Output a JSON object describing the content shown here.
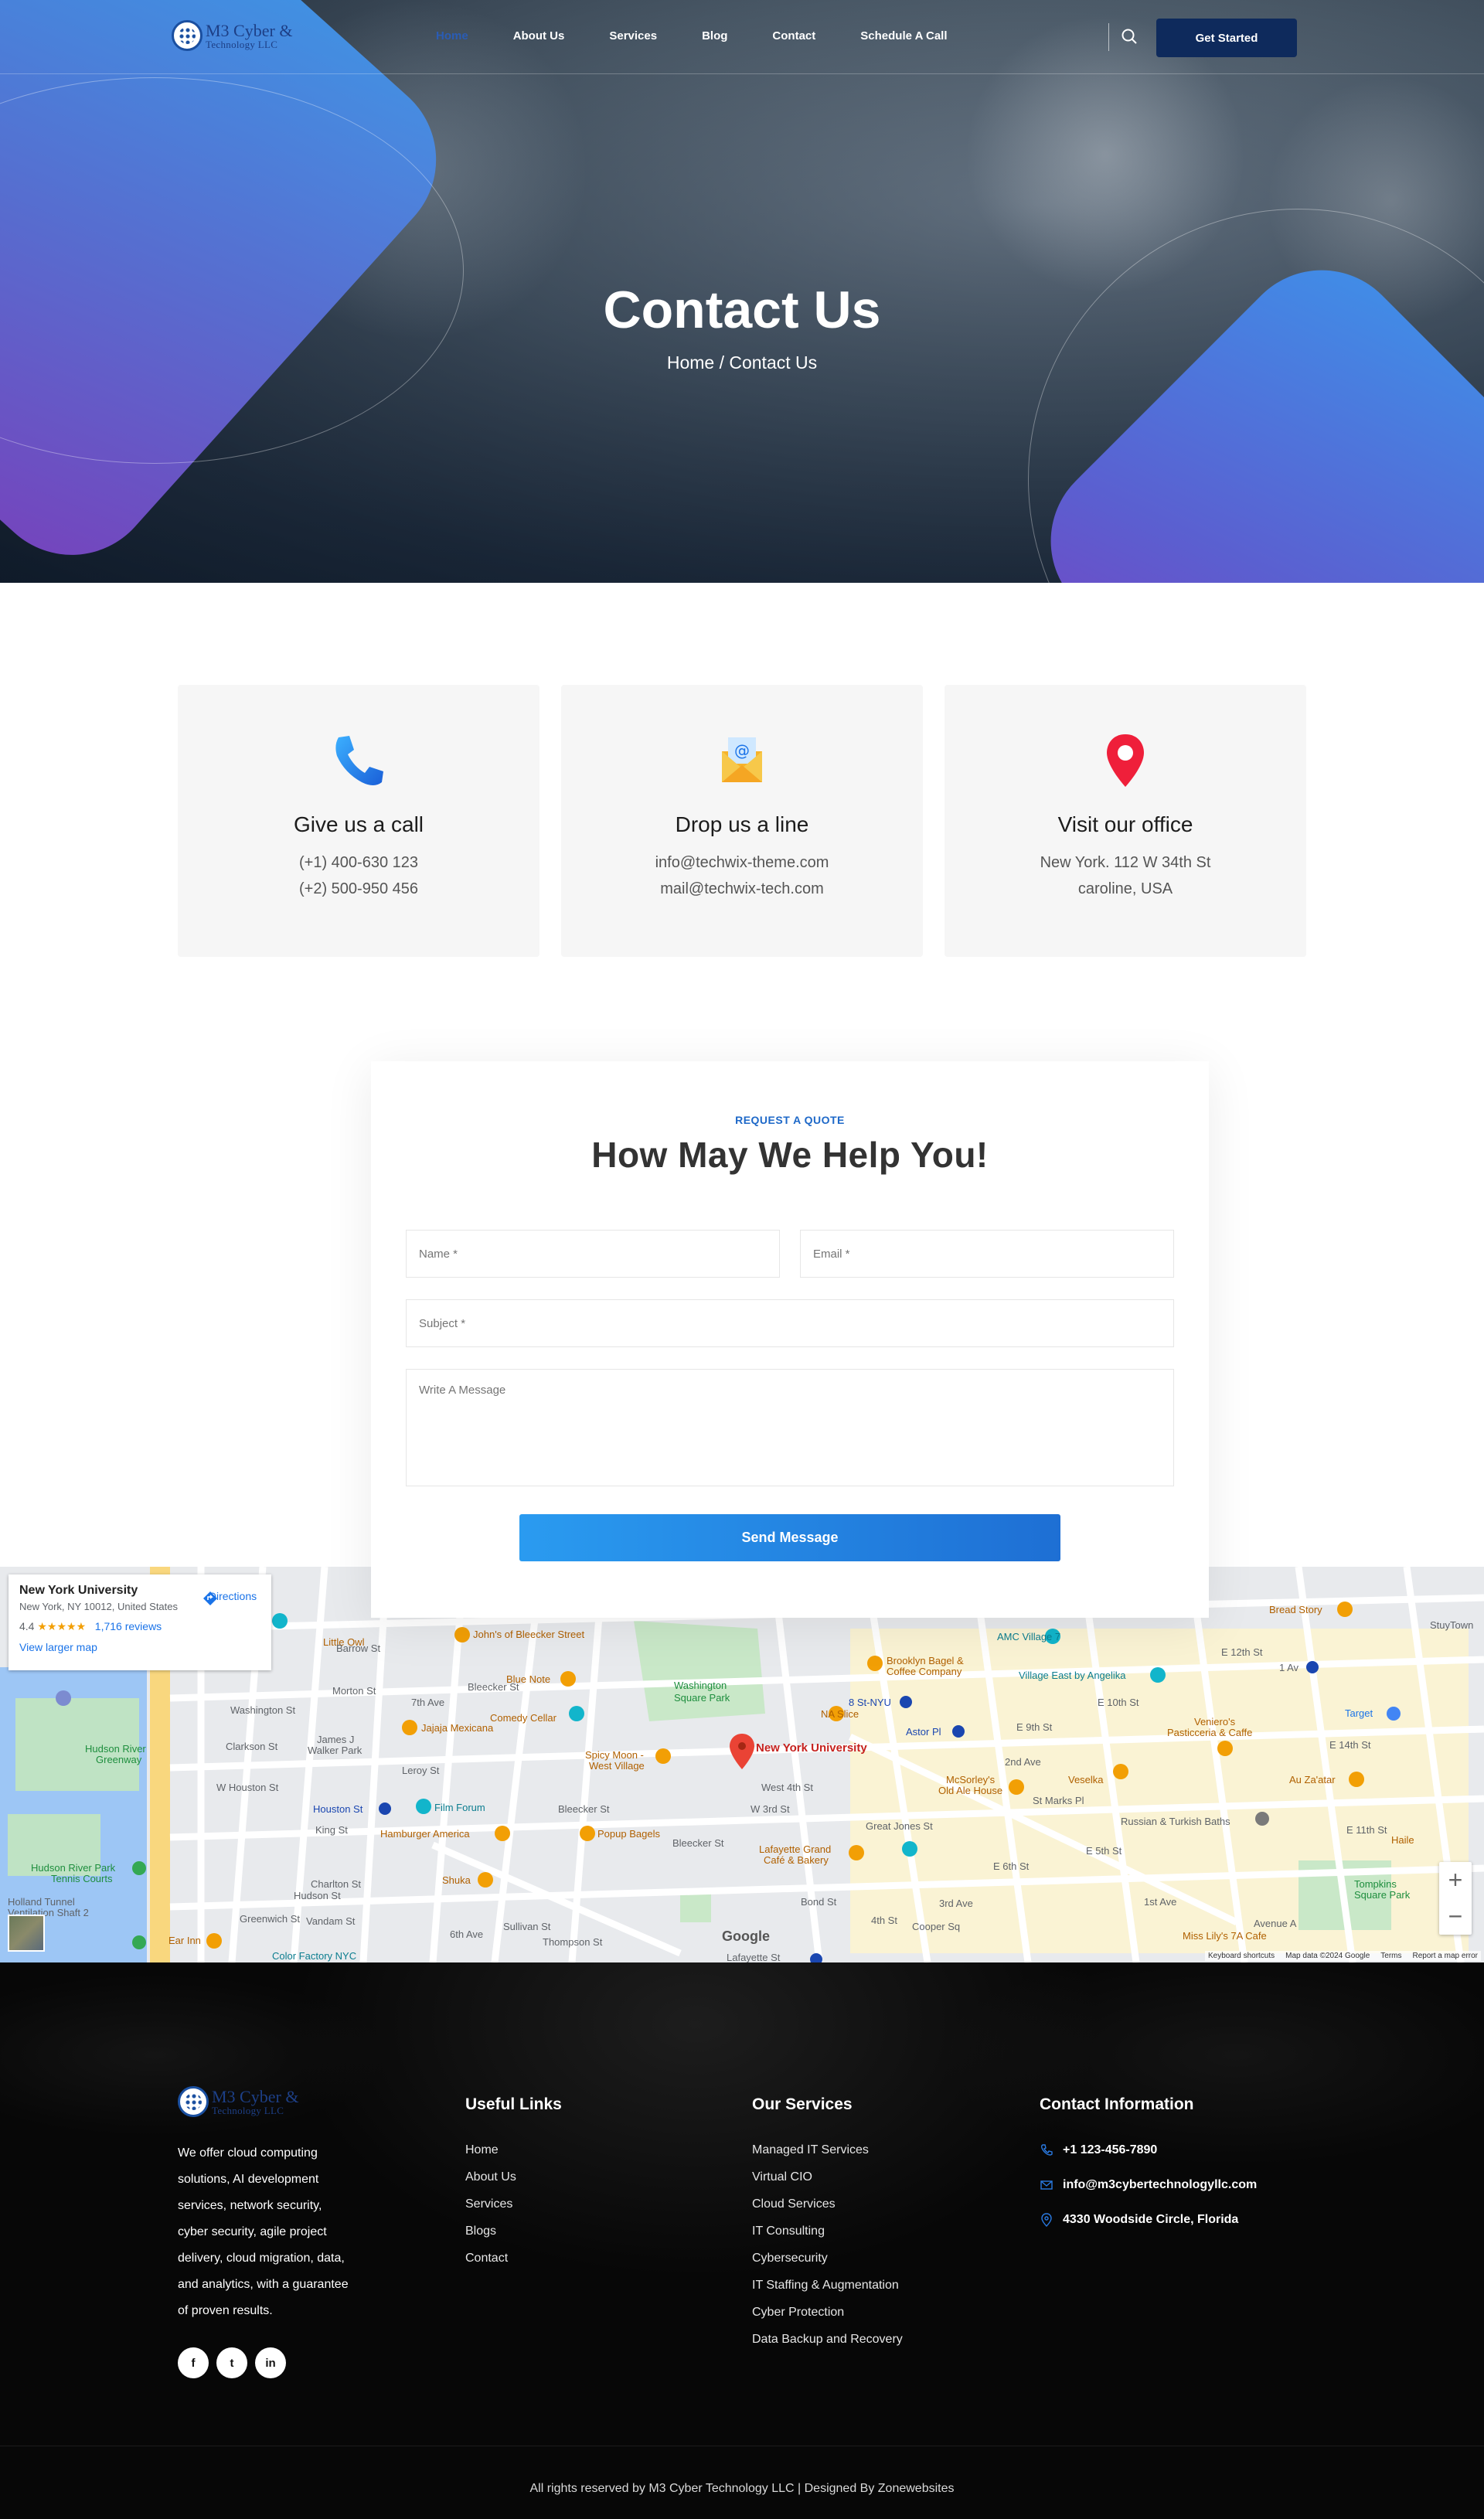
{
  "brand": {
    "name_line1": "M3 Cyber &",
    "name_line2": "Technology LLC"
  },
  "nav": {
    "items": [
      {
        "label": "Home",
        "active": true
      },
      {
        "label": "About Us"
      },
      {
        "label": "Services"
      },
      {
        "label": "Blog"
      },
      {
        "label": "Contact"
      },
      {
        "label": "Schedule A Call"
      }
    ],
    "cta_label": "Get Started",
    "search_icon": "search-icon"
  },
  "hero": {
    "title": "Contact Us",
    "breadcrumb": "Home / Contact Us"
  },
  "cards": [
    {
      "icon": "phone-icon",
      "title": "Give us a call",
      "lines": [
        "(+1) 400-630 123",
        "(+2) 500-950 456"
      ]
    },
    {
      "icon": "email-envelope-icon",
      "title": "Drop us a line",
      "lines": [
        "info@techwix-theme.com",
        "mail@techwix-tech.com"
      ]
    },
    {
      "icon": "location-pin-icon",
      "title": "Visit our office",
      "lines": [
        "New York. 112 W 34th St",
        "caroline, USA"
      ]
    }
  ],
  "form": {
    "kicker": "REQUEST A QUOTE",
    "title": "How May We Help You!",
    "name_placeholder": "Name *",
    "email_placeholder": "Email *",
    "subject_placeholder": "Subject *",
    "message_placeholder": "Write A Message",
    "submit_label": "Send Message"
  },
  "map": {
    "place_title": "New York University",
    "place_address": "New York, NY 10012, United States",
    "rating": "4.4",
    "stars": "★★★★★",
    "reviews": "1,716 reviews",
    "larger_map": "View larger map",
    "directions": "Directions",
    "pin_label": "New York University",
    "google": "Google",
    "footer_links": [
      "Keyboard shortcuts",
      "Map data ©2024 Google",
      "Terms",
      "Report a map error"
    ],
    "labels": [
      "Washington Square Park",
      "Bleecker St",
      "John's of Bleecker Street",
      "Blue Note",
      "Comedy Cellar",
      "Spicy Moon - West Village",
      "Popup Bagels",
      "Film Forum",
      "Jajaja Mexicana",
      "Hamburger America",
      "Shuka",
      "Brooklyn Bagel & Coffee Company",
      "AMC Village 7",
      "Village East by Angelika",
      "NA Slice",
      "8 St-NYU",
      "Astor Pl",
      "McSorley's Old Ale House",
      "Veselka",
      "Russian & Turkish Baths",
      "Lafayette Grand Café & Bakery",
      "Veniero's Pasticceria & Caffe",
      "Au Za'atar",
      "Bread Story",
      "Target",
      "Hudson River Greenway",
      "Hudson River Park Tennis Courts",
      "Holland Tunnel Ventilation Shaft 2",
      "James J Walker Park",
      "Houston St",
      "Little Owl",
      "Color Factory NYC",
      "Ear Inn",
      "Tompkins Square Park",
      "Miss Lily's 7A Cafe",
      "Haile",
      "StuyTown",
      "1 Av",
      "Morton St",
      "Barrow St",
      "W Houston St",
      "King St",
      "Charlton St",
      "Vandam St",
      "Clarkson St",
      "Leroy St",
      "West 4th St",
      "Bond St",
      "E 10th St",
      "E 12th St",
      "E 14th St",
      "2nd Ave",
      "3rd Ave",
      "Cooper Sq",
      "1st Ave",
      "Avenue A",
      "7th Ave",
      "6th Ave",
      "Sullivan St",
      "Thompson St",
      "Hudson St",
      "Greenwich St",
      "Washington St",
      "W 3rd St",
      "E 6th St",
      "E 5th St",
      "E 9th St",
      "E 11th St",
      "St Marks Pl",
      "4th St",
      "Great Jones St",
      "Lafayette St"
    ]
  },
  "footer": {
    "about": "We offer cloud computing solutions, AI development services, network security, cyber security, agile project delivery, cloud migration, data, and analytics, with a guarantee of proven results.",
    "social": [
      {
        "icon": "facebook-icon",
        "glyph": "f"
      },
      {
        "icon": "twitter-icon",
        "glyph": "t"
      },
      {
        "icon": "linkedin-icon",
        "glyph": "in"
      }
    ],
    "useful_links_title": "Useful Links",
    "useful_links": [
      "Home",
      "About Us",
      "Services",
      "Blogs",
      "Contact"
    ],
    "services_title": "Our Services",
    "services": [
      "Managed IT Services",
      "Virtual CIO",
      "Cloud Services",
      "IT Consulting",
      "Cybersecurity",
      "IT Staffing & Augmentation",
      "Cyber Protection",
      "Data Backup and Recovery"
    ],
    "contact_title": "Contact Information",
    "phone": "+1 123-456-7890",
    "email": "info@m3cybertechnologyllc.com",
    "address": "4330 Woodside Circle, Florida",
    "copyright": "All rights reserved by M3 Cyber Technology LLC | Designed By Zonewebsites"
  },
  "colors": {
    "accent": "#1d68c8",
    "cta": "#0e2a5c",
    "footer_bg": "#070707"
  }
}
